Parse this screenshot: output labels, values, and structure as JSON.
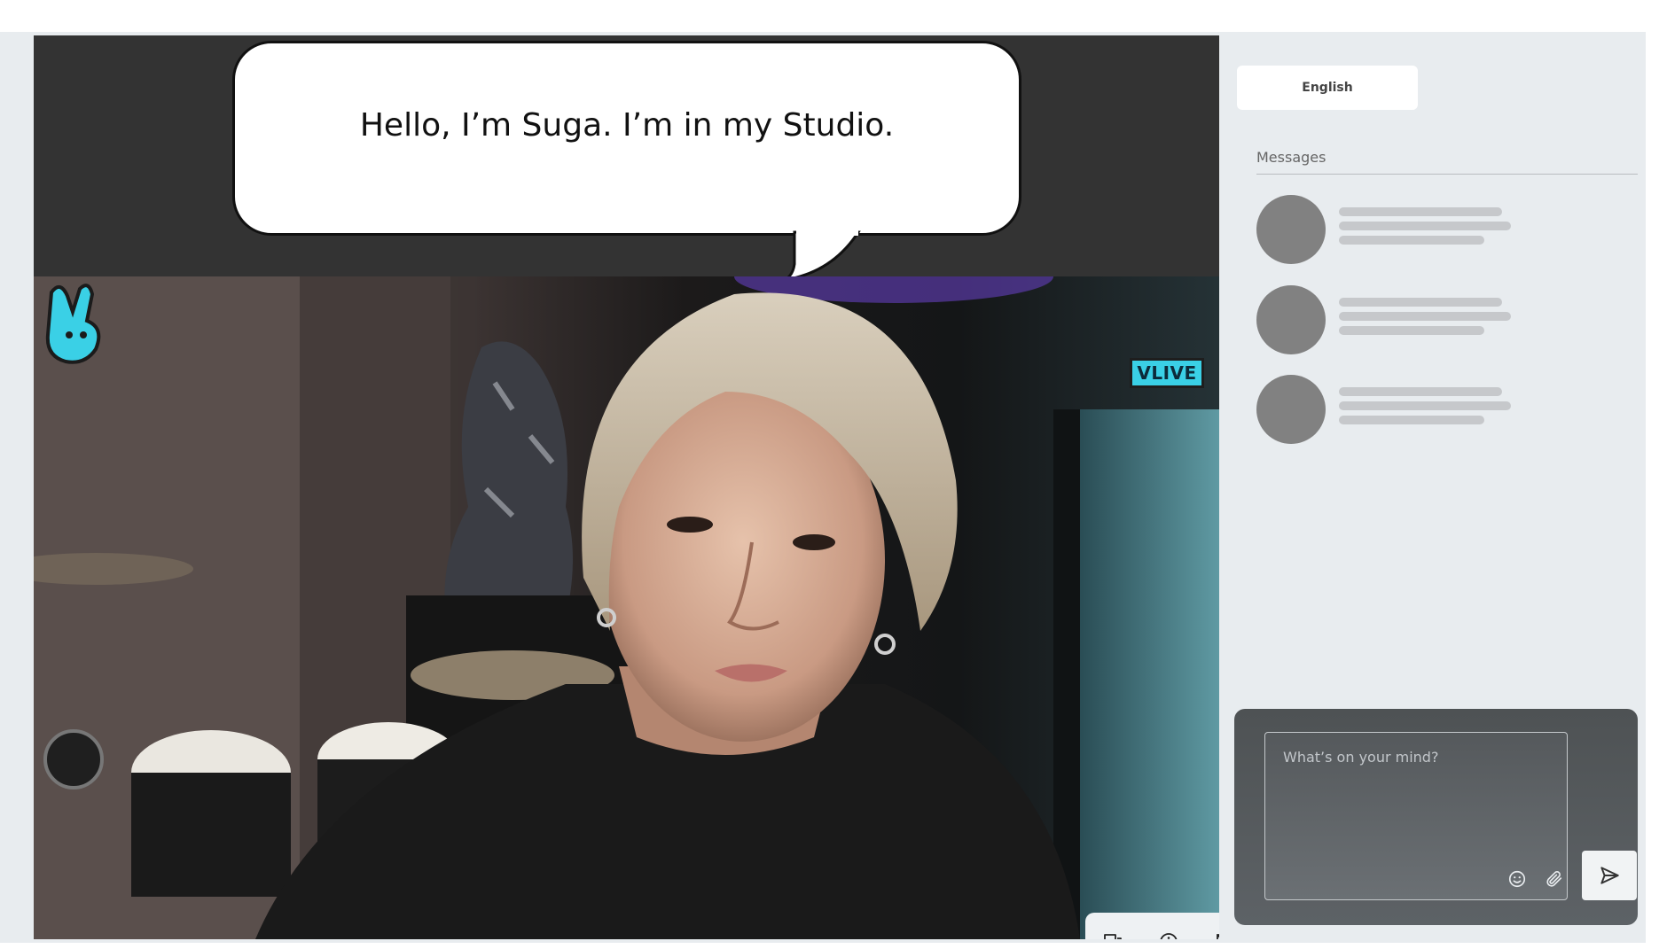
{
  "caption": {
    "text": "Hello, I’m Suga. I’m in my Studio."
  },
  "video": {
    "watermark": "VLIVE"
  },
  "controls": {
    "icons": [
      "chat-bubbles-icon",
      "info-icon",
      "fullscreen-icon"
    ]
  },
  "sidebar": {
    "language_label": "English",
    "messages_label": "Messages",
    "message_placeholders": 3
  },
  "composer": {
    "placeholder": "What’s on your mind?",
    "icons": [
      "emoji-icon",
      "paperclip-icon",
      "send-icon"
    ]
  },
  "colors": {
    "page_bg": "#e8ecef",
    "video_panel_bg": "#333333",
    "composer_bg": "#4e5254",
    "avatar_placeholder": "#818181",
    "skeleton_line": "#c6c8cb",
    "vlive_accent": "#3ad0e6"
  }
}
